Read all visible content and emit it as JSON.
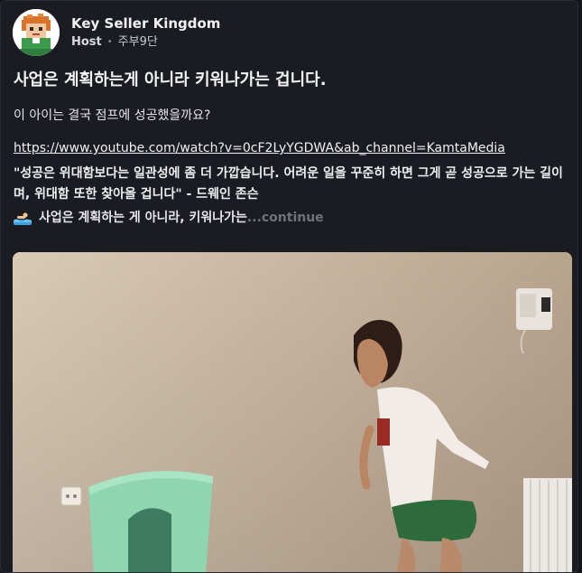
{
  "post": {
    "author": "Key Seller Kingdom",
    "role": "Host",
    "separator": "•",
    "time": "주부9단",
    "title": "사업은 계획하는게 아니라 키워나가는 겁니다.",
    "question": "이 아이는 결국 점프에 성공했을까요?",
    "link": "https://www.youtube.com/watch?v=0cF2LyYGDWA&ab_channel=KamtaMedia",
    "quote": "\"성공은 위대함보다는 일관성에 좀 더 가깝습니다. 어려운 일을 꾸준히 하면 그게 곧 성공으로 가는 길이며, 위대함 또한 찾아올 겁니다\" - 드웨인 존슨",
    "summary": "사업은 계획하는 게 아니라, 키워나가는",
    "continue": "...continue"
  },
  "icons": {
    "avatar": "pixel-boy-avatar",
    "summary_emoji": "swimmer-emoji"
  },
  "colors": {
    "background": "#14151a",
    "card": "#1b1c22",
    "text": "#e9eaee",
    "muted": "#6f717c",
    "media_wall": "#cbb9a4",
    "stool": "#8fd6b0"
  }
}
